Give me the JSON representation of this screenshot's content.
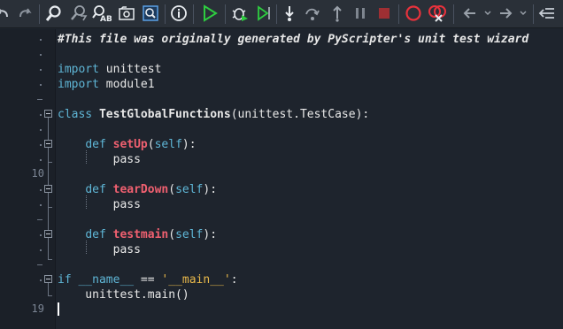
{
  "toolbar": {
    "buttons": [
      {
        "name": "undo-button",
        "icon": "undo-icon"
      },
      {
        "name": "redo-button",
        "icon": "redo-icon"
      },
      {
        "name": "find-button",
        "icon": "search-icon"
      },
      {
        "name": "replace-button",
        "icon": "search-replace-icon"
      },
      {
        "name": "find-in-files-button",
        "icon": "find-in-files-icon"
      },
      {
        "name": "find-in-folder-button",
        "icon": "folder-search-icon"
      },
      {
        "name": "highlight-search-button",
        "icon": "highlight-search-icon"
      },
      {
        "name": "about-button",
        "icon": "info-icon"
      },
      {
        "name": "run-button",
        "icon": "play-icon"
      },
      {
        "name": "debug-button",
        "icon": "bug-icon"
      },
      {
        "name": "run-to-cursor-button",
        "icon": "run-to-cursor-icon"
      },
      {
        "name": "step-into-button",
        "icon": "step-into-icon"
      },
      {
        "name": "step-over-button",
        "icon": "step-over-icon"
      },
      {
        "name": "step-out-button",
        "icon": "step-out-icon"
      },
      {
        "name": "pause-button",
        "icon": "pause-icon"
      },
      {
        "name": "abort-button",
        "icon": "stop-icon"
      },
      {
        "name": "toggle-breakpoint-button",
        "icon": "breakpoint-icon"
      },
      {
        "name": "clear-breakpoints-button",
        "icon": "clear-breakpoints-icon"
      },
      {
        "name": "back-button",
        "icon": "arrow-left-icon"
      },
      {
        "name": "forward-button",
        "icon": "arrow-right-icon"
      },
      {
        "name": "toolbar-options-button",
        "icon": "toolbar-options-icon"
      }
    ]
  },
  "editor": {
    "gutter": {
      "line_numbers": [
        {
          "line": 10,
          "text": "10"
        },
        {
          "line": 19,
          "text": "19"
        }
      ]
    },
    "lines": [
      {
        "n": 1,
        "tokens": [
          {
            "t": "#This file was originally generated by PyScripter's unit test wizard",
            "c": "comment"
          }
        ]
      },
      {
        "n": 2,
        "tokens": []
      },
      {
        "n": 3,
        "tokens": [
          {
            "t": "import",
            "c": "kw"
          },
          {
            "t": " unittest",
            "c": "plain"
          }
        ]
      },
      {
        "n": 4,
        "tokens": [
          {
            "t": "import",
            "c": "kw"
          },
          {
            "t": " module1",
            "c": "plain"
          }
        ]
      },
      {
        "n": 5,
        "tokens": []
      },
      {
        "n": 6,
        "tokens": [
          {
            "t": "class",
            "c": "kw"
          },
          {
            "t": " ",
            "c": "plain"
          },
          {
            "t": "TestGlobalFunctions",
            "c": "cls"
          },
          {
            "t": "(unittest.TestCase):",
            "c": "plain"
          }
        ]
      },
      {
        "n": 7,
        "tokens": []
      },
      {
        "n": 8,
        "tokens": [
          {
            "t": "    ",
            "c": "plain"
          },
          {
            "t": "def",
            "c": "kw"
          },
          {
            "t": " ",
            "c": "plain"
          },
          {
            "t": "setUp",
            "c": "fn"
          },
          {
            "t": "(",
            "c": "plain"
          },
          {
            "t": "self",
            "c": "selfc"
          },
          {
            "t": "):",
            "c": "plain"
          }
        ]
      },
      {
        "n": 9,
        "tokens": [
          {
            "t": "        pass",
            "c": "plain"
          }
        ]
      },
      {
        "n": 10,
        "tokens": []
      },
      {
        "n": 11,
        "tokens": [
          {
            "t": "    ",
            "c": "plain"
          },
          {
            "t": "def",
            "c": "kw"
          },
          {
            "t": " ",
            "c": "plain"
          },
          {
            "t": "tearDown",
            "c": "fn"
          },
          {
            "t": "(",
            "c": "plain"
          },
          {
            "t": "self",
            "c": "selfc"
          },
          {
            "t": "):",
            "c": "plain"
          }
        ]
      },
      {
        "n": 12,
        "tokens": [
          {
            "t": "        pass",
            "c": "plain"
          }
        ]
      },
      {
        "n": 13,
        "tokens": []
      },
      {
        "n": 14,
        "tokens": [
          {
            "t": "    ",
            "c": "plain"
          },
          {
            "t": "def",
            "c": "kw"
          },
          {
            "t": " ",
            "c": "plain"
          },
          {
            "t": "testmain",
            "c": "fn"
          },
          {
            "t": "(",
            "c": "plain"
          },
          {
            "t": "self",
            "c": "selfc"
          },
          {
            "t": "):",
            "c": "plain"
          }
        ]
      },
      {
        "n": 15,
        "tokens": [
          {
            "t": "        pass",
            "c": "plain"
          }
        ]
      },
      {
        "n": 16,
        "tokens": []
      },
      {
        "n": 17,
        "tokens": [
          {
            "t": "if",
            "c": "kw"
          },
          {
            "t": " ",
            "c": "plain"
          },
          {
            "t": "__name__",
            "c": "dunder"
          },
          {
            "t": " == ",
            "c": "plain"
          },
          {
            "t": "'__main__'",
            "c": "str"
          },
          {
            "t": ":",
            "c": "plain"
          }
        ]
      },
      {
        "n": 18,
        "tokens": [
          {
            "t": "    unittest.main()",
            "c": "plain"
          }
        ]
      },
      {
        "n": 19,
        "tokens": []
      }
    ]
  }
}
